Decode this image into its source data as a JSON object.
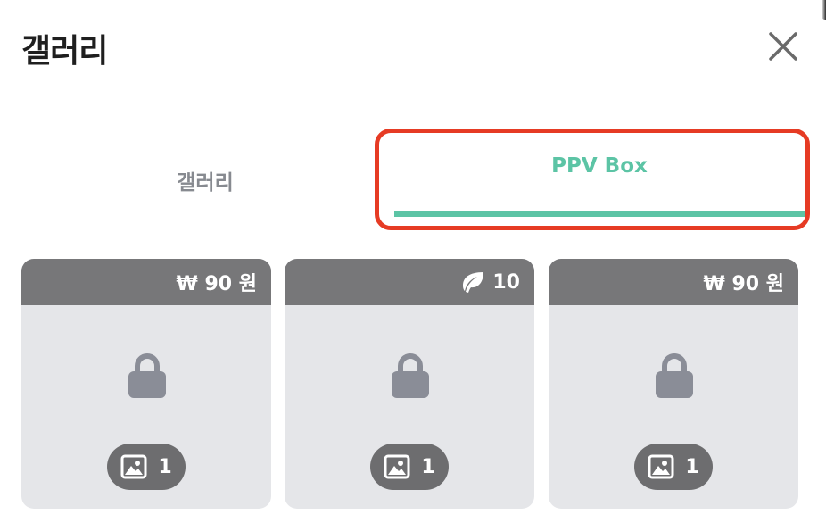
{
  "header": {
    "title": "갤러리",
    "close_icon": "close-icon"
  },
  "tabs": [
    {
      "label": "갤러리",
      "active": false
    },
    {
      "label": "PPV Box",
      "active": true
    }
  ],
  "colors": {
    "accent": "#5cc4a5",
    "highlight": "#e63b24",
    "card_header": "#777779",
    "card_body": "#e5e6e9",
    "lock": "#8a8d97"
  },
  "cards": [
    {
      "price_icon": "won-currency-icon",
      "price_text": "₩ 90 원",
      "media_icon": "image-icon",
      "media_count": "1",
      "locked": true
    },
    {
      "price_icon": "leaf-icon",
      "price_text": "10",
      "media_icon": "image-icon",
      "media_count": "1",
      "locked": true
    },
    {
      "price_icon": "won-currency-icon",
      "price_text": "₩ 90 원",
      "media_icon": "image-icon",
      "media_count": "1",
      "locked": true
    }
  ]
}
